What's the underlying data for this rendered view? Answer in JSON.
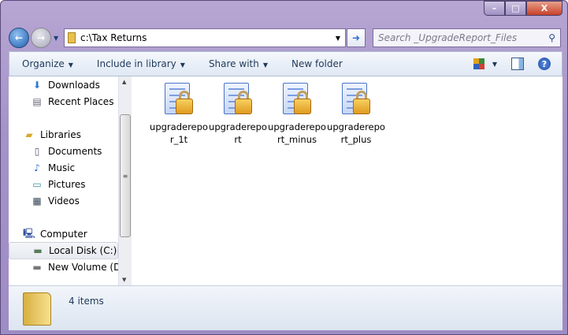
{
  "window": {
    "minimize": "–",
    "maximize": "□",
    "close": "X"
  },
  "address": {
    "path": "c:\\Tax Returns",
    "go": "➜"
  },
  "search": {
    "placeholder": "Search _UpgradeReport_Files",
    "icon": "magnifier-icon"
  },
  "toolbar": {
    "organize": "Organize",
    "include": "Include in library",
    "share": "Share with",
    "new_folder": "New folder",
    "help": "?"
  },
  "nav": {
    "favorites": [
      {
        "label": "Downloads",
        "icon": "downloads-icon"
      },
      {
        "label": "Recent Places",
        "icon": "recent-places-icon"
      }
    ],
    "libraries": {
      "label": "Libraries",
      "items": [
        {
          "label": "Documents"
        },
        {
          "label": "Music"
        },
        {
          "label": "Pictures"
        },
        {
          "label": "Videos"
        }
      ]
    },
    "computer": {
      "label": "Computer",
      "items": [
        {
          "label": "Local Disk (C:)",
          "selected": true
        },
        {
          "label": "New Volume (D:)"
        }
      ]
    }
  },
  "files": [
    {
      "name": "upgraderepor_1t"
    },
    {
      "name": "upgradereport"
    },
    {
      "name": "upgradereport_minus"
    },
    {
      "name": "upgradereport_plus"
    }
  ],
  "status": {
    "count": "4 items"
  }
}
